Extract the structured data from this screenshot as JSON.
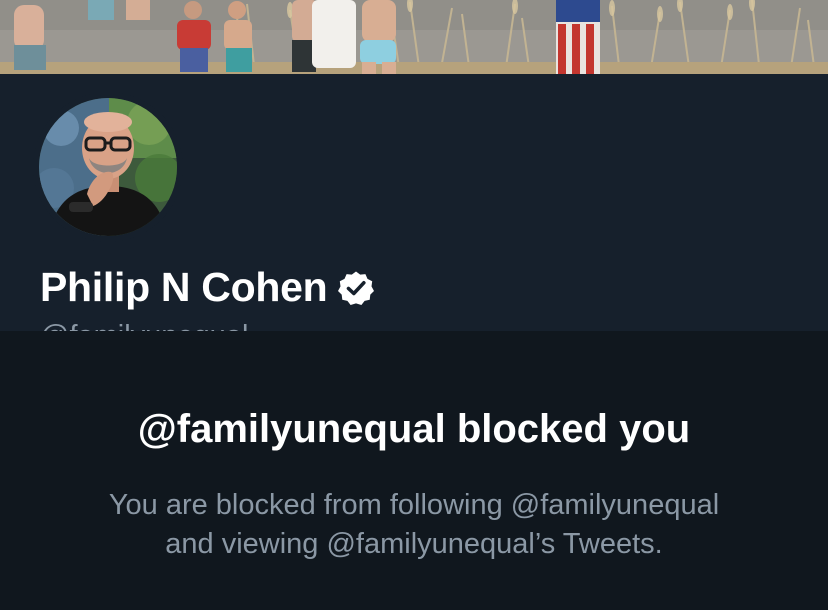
{
  "profile": {
    "display_name": "Philip N Cohen",
    "handle": "@familyunequal",
    "verified_icon": "verified-badge-icon",
    "avatar_icon": "profile-photo",
    "banner_icon": "beach-photo"
  },
  "blocked": {
    "title": "@familyunequal blocked you",
    "line1": "You are blocked from following @familyunequal",
    "line2": "and viewing @familyunequal’s Tweets."
  },
  "colors": {
    "background": "#15202b",
    "profile_background": "#16202c",
    "blocked_background": "#10171e",
    "primary_text": "#ffffff",
    "secondary_text": "#8b98a5"
  }
}
